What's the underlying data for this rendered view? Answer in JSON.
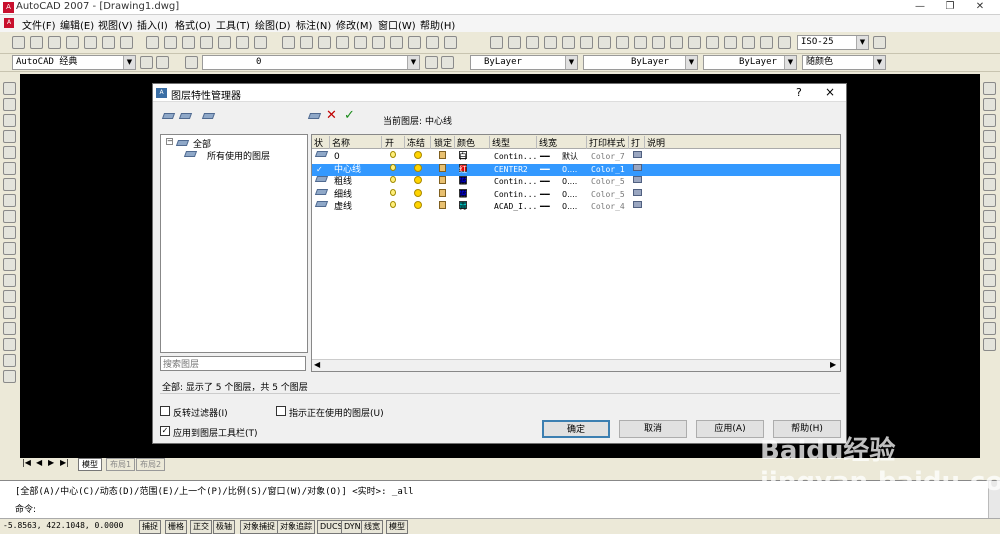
{
  "app": {
    "title": "AutoCAD 2007 - [Drawing1.dwg]"
  },
  "menu": [
    "文件(F)",
    "编辑(E)",
    "视图(V)",
    "插入(I)",
    "格式(O)",
    "工具(T)",
    "绘图(D)",
    "标注(N)",
    "修改(M)",
    "窗口(W)",
    "帮助(H)"
  ],
  "toolbar2": {
    "workspace": "AutoCAD 经典",
    "layer": "0",
    "dimstyle": "ISO-25",
    "color": "ByLayer",
    "linetype": "ByLayer",
    "lineweight": "ByLayer",
    "plotstyle": "随颜色"
  },
  "dialog": {
    "title": "图层特性管理器",
    "current_layer_label": "当前图层:",
    "current_layer": "中心线",
    "help": "?",
    "close": "×",
    "tree": {
      "root": "全部",
      "child": "所有使用的图层"
    },
    "search_placeholder": "搜索图层",
    "columns": [
      "状",
      "名称",
      "开",
      "冻结",
      "锁定",
      "颜色",
      "线型",
      "线宽",
      "打印样式",
      "打",
      "说明"
    ],
    "rows": [
      {
        "name": "0",
        "color_name": "白",
        "color": "#ffffff",
        "linetype": "Contin...",
        "lineweight": "默认",
        "plot_style": "Color_7",
        "selected": false,
        "current": false
      },
      {
        "name": "中心线",
        "color_name": "红",
        "color": "#e00000",
        "linetype": "CENTER2",
        "lineweight": "0....",
        "plot_style": "Color_1",
        "selected": true,
        "current": true
      },
      {
        "name": "粗线",
        "color_name": "蓝",
        "color": "#0000d0",
        "linetype": "Contin...",
        "lineweight": "0....",
        "plot_style": "Color_5",
        "selected": false,
        "current": false
      },
      {
        "name": "细线",
        "color_name": "蓝",
        "color": "#0000d0",
        "linetype": "Contin...",
        "lineweight": "0....",
        "plot_style": "Color_5",
        "selected": false,
        "current": false
      },
      {
        "name": "虚线",
        "color_name": "青",
        "color": "#00c0c0",
        "linetype": "ACAD_I...",
        "lineweight": "0....",
        "plot_style": "Color_4",
        "selected": false,
        "current": false
      }
    ],
    "summary": "全部: 显示了 5 个图层，共 5 个图层",
    "invert_filter": "反转过滤器(I)",
    "indicate_used": "指示正在使用的图层(U)",
    "apply_toolbar": "应用到图层工具栏(T)",
    "buttons": {
      "ok": "确定",
      "cancel": "取消",
      "apply": "应用(A)",
      "help": "帮助(H)"
    }
  },
  "tabs": [
    "模型",
    "布局1",
    "布局2"
  ],
  "command": {
    "line1": "[全部(A)/中心(C)/动态(D)/范围(E)/上一个(P)/比例(S)/窗口(W)/对象(O)] <实时>: _all",
    "line2": "命令:"
  },
  "status": {
    "coords": "-5.8563,  422.1048, 0.0000",
    "toggles": [
      "捕捉",
      "栅格",
      "正交",
      "极轴",
      "对象捕捉",
      "对象追踪",
      "DUCS",
      "DYN",
      "线宽",
      "模型"
    ]
  },
  "watermark": "Baidu经验 jingyan.baidu.com"
}
